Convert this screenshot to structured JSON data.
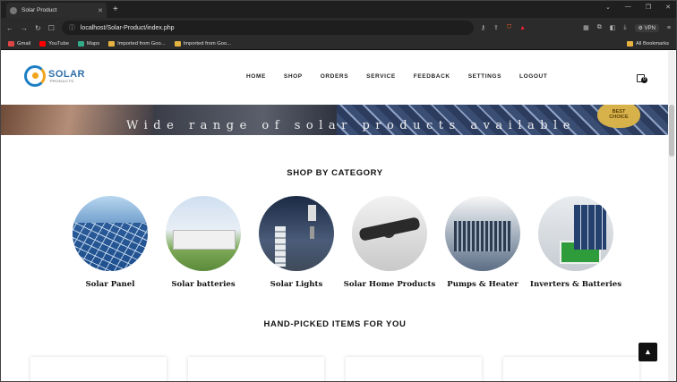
{
  "browser": {
    "tab_title": "Solar Product",
    "new_tab": "+",
    "address": "localhost/Solar-Product/index.php",
    "vpn": "VPN",
    "bookmarks": [
      "Gmail",
      "YouTube",
      "Maps",
      "Imported from Goo...",
      "Imported from Goo..."
    ],
    "all_bookmarks": "All Bookmarks"
  },
  "nav": {
    "logo_title": "SOLAR",
    "logo_sub": "PRODUCTS",
    "menu": [
      "HOME",
      "SHOP",
      "ORDERS",
      "SERVICE",
      "FEEDBACK",
      "SETTINGS",
      "LOGOUT"
    ],
    "cart_count": "0"
  },
  "banner": {
    "text": "Wide range of solar products available",
    "seal_line1": "BEST",
    "seal_line2": "CHOICE"
  },
  "shop": {
    "title": "SHOP BY CATEGORY",
    "categories": [
      "Solar Panel",
      "Solar batteries",
      "Solar Lights",
      "Solar Home Products",
      "Pumps & Heater",
      "Inverters & Batteries"
    ]
  },
  "handpicked": {
    "title": "HAND-PICKED ITEMS FOR YOU"
  },
  "scroll_top": "▲"
}
